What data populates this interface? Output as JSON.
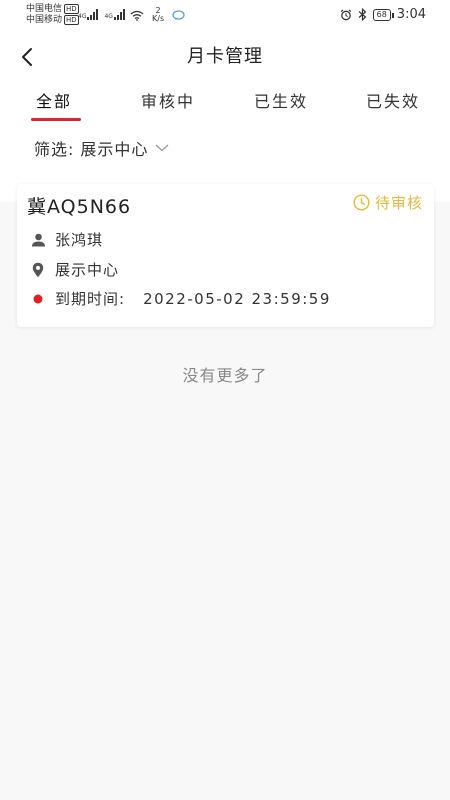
{
  "status_bar": {
    "carrier1": "中国电信",
    "carrier2": "中国移动",
    "hd": "HD",
    "network1": "4G",
    "network2": "4G",
    "speed_value": "2",
    "speed_unit": "K/s",
    "battery": "68",
    "time": "3:04"
  },
  "header": {
    "title": "月卡管理"
  },
  "tabs": [
    {
      "label": "全部",
      "active": true
    },
    {
      "label": "审核中"
    },
    {
      "label": "已生效"
    },
    {
      "label": "已失效"
    }
  ],
  "filter": {
    "label": "筛选:",
    "value": "展示中心"
  },
  "cards": [
    {
      "plate": "冀AQ5N66",
      "status": "待审核",
      "owner": "张鸿琪",
      "location": "展示中心",
      "expiry_label": "到期时间:",
      "expiry_value": "2022-05-02 23:59:59"
    }
  ],
  "footer": {
    "no_more": "没有更多了"
  },
  "colors": {
    "accent_red": "#d42a2a",
    "pending_yellow": "#e6b93a",
    "dot_red": "#e02020"
  }
}
